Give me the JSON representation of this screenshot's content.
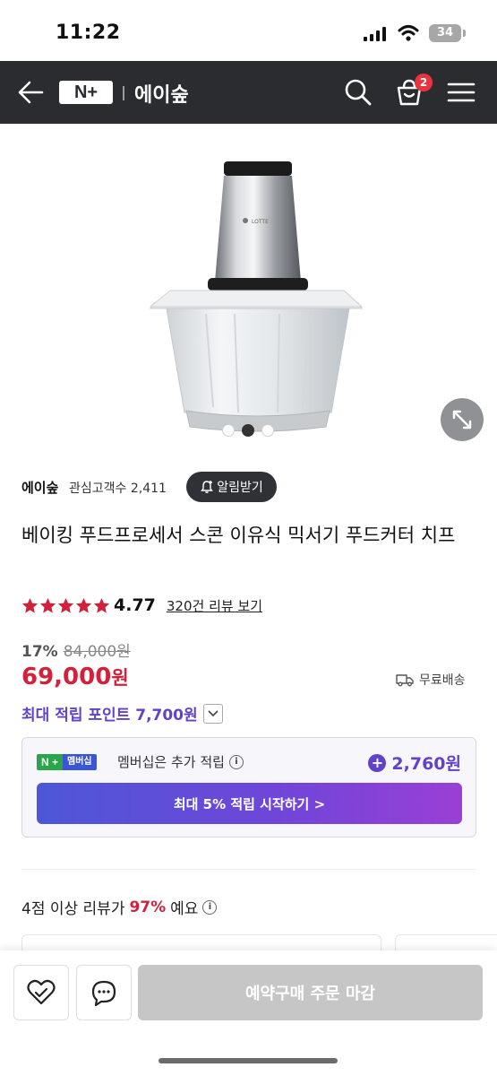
{
  "status_bar": {
    "time": "11:22",
    "battery": "34",
    "icons": [
      "signal-icon",
      "wifi-icon",
      "battery-icon"
    ]
  },
  "header": {
    "logo": "N+",
    "store_name": "에이숲",
    "cart_count": "2",
    "icons": [
      "back-arrow-icon",
      "search-icon",
      "cart-icon",
      "menu-icon"
    ],
    "bg_color": "#2a2c2f"
  },
  "gallery": {
    "image_label": "LOTTE",
    "total_images": 3,
    "active_index": 1,
    "expand_icon": "expand-icon"
  },
  "seller": {
    "name": "에이숲",
    "followers_label": "관심고객수 2,411",
    "notify_label": "알림받기"
  },
  "product": {
    "title": "베이킹 푸드프로세서 스콘 이유식 믹서기 푸드커터 치프",
    "rating": "4.77",
    "rating_stars": 5,
    "review_link": "320건 리뷰 보기",
    "discount": "17%",
    "original_price": "84,000원",
    "sale_price": "69,000",
    "sale_price_unit": "원",
    "shipping": "무료배송",
    "points": "최대 적립 포인트 7,700원"
  },
  "membership": {
    "badge_left": "N +",
    "badge_right": "멤버십",
    "text": "멤버십은 추가 적립",
    "extra_points": "2,760원",
    "cta": "최대 5% 적립 시작하기 >"
  },
  "reviews": {
    "summary_prefix": "4점 이상 리뷰가",
    "summary_pct": "97%",
    "summary_suffix": "예요"
  },
  "bottom_bar": {
    "order_label": "예약구매 주문 마감",
    "icons": [
      "wishlist-heart-icon",
      "chat-icon"
    ]
  },
  "colors": {
    "accent_red": "#d1213b",
    "accent_purple": "#6142c8",
    "star": "#d1213b"
  }
}
